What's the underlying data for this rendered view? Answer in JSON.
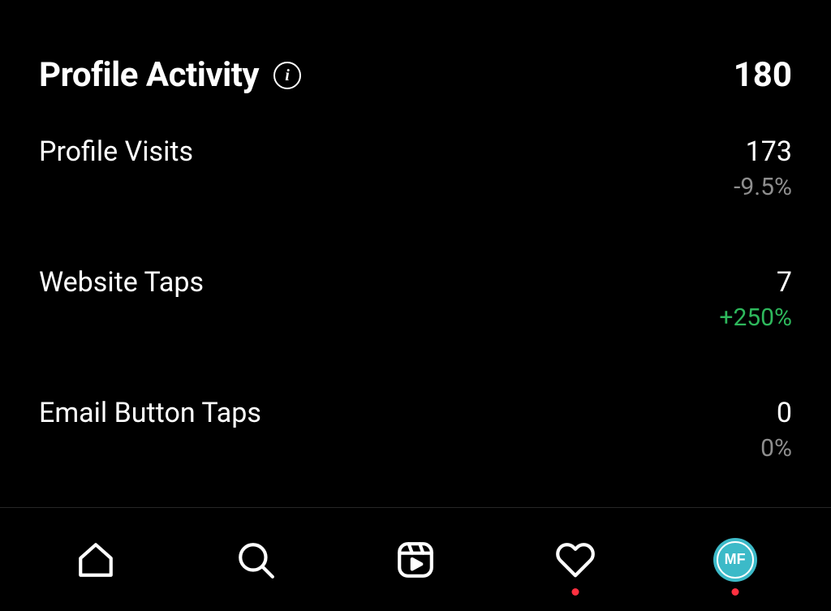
{
  "header": {
    "title": "Profile Activity",
    "total": "180"
  },
  "metrics": [
    {
      "label": "Profile Visits",
      "value": "173",
      "delta": "-9.5%",
      "delta_type": "neutral"
    },
    {
      "label": "Website Taps",
      "value": "7",
      "delta": "+250%",
      "delta_type": "positive"
    },
    {
      "label": "Email Button Taps",
      "value": "0",
      "delta": "0%",
      "delta_type": "neutral"
    }
  ],
  "nav": {
    "avatar_text": "MF"
  }
}
